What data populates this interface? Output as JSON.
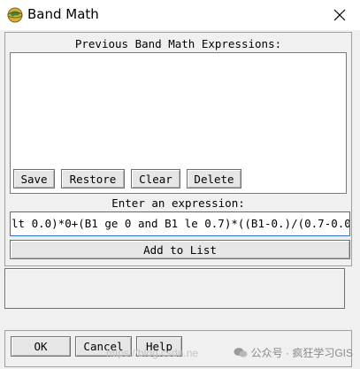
{
  "window": {
    "title": "Band Math",
    "close_glyph": "✕"
  },
  "previous": {
    "label": "Previous Band Math Expressions:",
    "items": []
  },
  "list_buttons": {
    "save": "Save",
    "restore": "Restore",
    "clear": "Clear",
    "delete": "Delete"
  },
  "expression": {
    "label": "Enter an expression:",
    "value": " lt 0.0)*0+(B1 ge 0 and B1 le 0.7)*((B1-0.)/(0.7-0.0"
  },
  "add_button": "Add to List",
  "status_text": "",
  "dialog_buttons": {
    "ok": "OK",
    "cancel": "Cancel",
    "help": "Help"
  },
  "watermark": {
    "url": "https://blog.csdn.ne",
    "account": "公众号 · 疯狂学习GIS"
  },
  "colors": {
    "focus_border": "#2f70c9",
    "dialog_bg": "#f0f0f0"
  },
  "icons": {
    "app": "envi-globe-icon",
    "close": "close-icon",
    "wechat": "wechat-icon"
  }
}
